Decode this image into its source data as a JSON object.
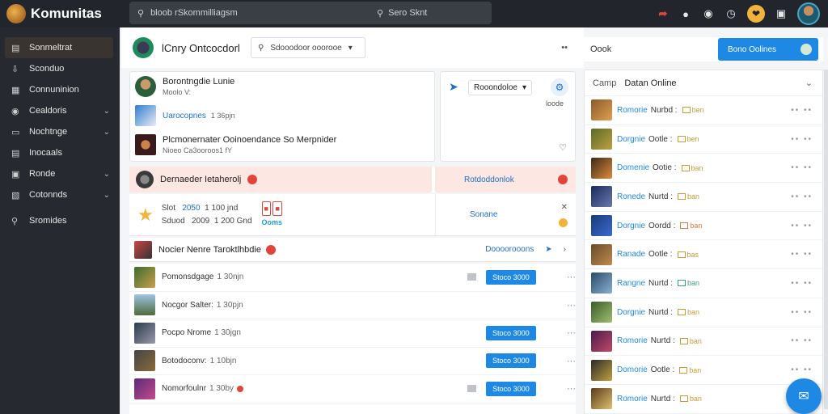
{
  "app": {
    "name": "Komunitas"
  },
  "topbar": {
    "crumb": "bloob rSkommilliagsm",
    "search_label": "Sero Sknt",
    "icons": [
      "bolt-icon",
      "chat-icon",
      "message-icon",
      "clock-icon",
      "coin-icon",
      "window-icon"
    ]
  },
  "sidebar": {
    "items": [
      {
        "label": "Sonmeltrat",
        "icon": "list-icon",
        "active": true,
        "chevron": false
      },
      {
        "label": "Sconduo",
        "icon": "download-icon",
        "active": false,
        "chevron": false
      },
      {
        "label": "Connuninion",
        "icon": "grid-icon",
        "active": false,
        "chevron": false
      },
      {
        "label": "Cealdoris",
        "icon": "toggle-icon",
        "active": false,
        "chevron": true
      },
      {
        "label": "Nochtnge",
        "icon": "card-icon",
        "active": false,
        "chevron": true
      },
      {
        "label": "Inocaals",
        "icon": "doc-icon",
        "active": false,
        "chevron": false
      },
      {
        "label": "Ronde",
        "icon": "square-icon",
        "active": false,
        "chevron": true
      },
      {
        "label": "Cotonnds",
        "icon": "calendar-icon",
        "active": false,
        "chevron": true
      },
      {
        "label": "Sromides",
        "icon": "search-icon",
        "active": false,
        "chevron": false
      }
    ]
  },
  "main": {
    "header_title": "lCnry Ontcocdorl",
    "search_placeholder": "Sdooodoor ooorooe",
    "card_a": [
      {
        "title": "Borontngdie Lunie",
        "sub": "Moolo V:"
      },
      {
        "title": "Uarocopnes",
        "sub": "1 36pjn",
        "link": true
      },
      {
        "title": "Plcmonernater Ooinoendance So Merpnider",
        "sub": "Nioeo Ca3ooroos1 fY"
      }
    ],
    "card_b": {
      "label": "Rooondoloe",
      "count": "loode"
    },
    "band": {
      "left": "Dernaeder Ietaherolj",
      "right": "Rotdoddonlok"
    },
    "feat": {
      "line1_a": "Slot",
      "line1_b": "2050",
      "line1_c": "1 100 jnd",
      "line2_a": "Sduod",
      "line2_b": "2009",
      "line2_c": "1 200 Gnd",
      "tag": "Ooms",
      "right": "Sonane"
    },
    "list_head": {
      "title": "Nocier Nenre  Taroktlhbdie",
      "action": "Doooorooons"
    },
    "rows": [
      {
        "name": "Pomonsdgage",
        "time": "1 30njn",
        "button": "Stoco 3000",
        "sq": true,
        "red": false
      },
      {
        "name": "Nocgor Salter:",
        "time": "1 30pjn",
        "button": "",
        "sq": false,
        "red": false
      },
      {
        "name": "Pocpo Nrome",
        "time": "1 30jgn",
        "button": "Stoco 3000",
        "sq": false,
        "red": false
      },
      {
        "name": "Botodoconv:",
        "time": "1 10bjn",
        "button": "Stoco 3000",
        "sq": false,
        "red": false
      },
      {
        "name": "Nomorfoulnr",
        "time": "1 30by",
        "button": "Stoco 3000",
        "sq": true,
        "red": true
      }
    ]
  },
  "right": {
    "book_label": "Oook",
    "action_button": "Bono Oolines",
    "panel_prefix": "Camp",
    "panel_title": "Datan Online",
    "online": [
      {
        "name": "Romorie",
        "status": "Nurbd :",
        "chip": "ben",
        "chip_color": "#c79a3a"
      },
      {
        "name": "Dorgnie",
        "status": "Ootle :",
        "chip": "ben",
        "chip_color": "#c79a3a"
      },
      {
        "name": "Domenie",
        "status": "Ootie :",
        "chip": "ban",
        "chip_color": "#c79a3a"
      },
      {
        "name": "Ronede",
        "status": "Nurtd :",
        "chip": "ban",
        "chip_color": "#c79a3a"
      },
      {
        "name": "Dorgnie",
        "status": "Oordd :",
        "chip": "ban",
        "chip_color": "#e07a3a"
      },
      {
        "name": "Ranade",
        "status": "Ootle :",
        "chip": "bas",
        "chip_color": "#c79a3a"
      },
      {
        "name": "Rangne",
        "status": "Nurtd :",
        "chip": "ban",
        "chip_color": "#3aa07a"
      },
      {
        "name": "Dorgnie",
        "status": "Nurtd :",
        "chip": "ban",
        "chip_color": "#c79a3a"
      },
      {
        "name": "Romorie",
        "status": "Nurtd :",
        "chip": "ban",
        "chip_color": "#c79a3a"
      },
      {
        "name": "Domorie",
        "status": "Ootle :",
        "chip": "ban",
        "chip_color": "#c79a3a"
      },
      {
        "name": "Romorie",
        "status": "Nurtd :",
        "chip": "ban",
        "chip_color": "#c79a3a"
      }
    ]
  },
  "colors": {
    "accent": "#1e88e5",
    "danger": "#e0443a",
    "warning": "#f2b33d",
    "sidebar": "#262a30"
  }
}
